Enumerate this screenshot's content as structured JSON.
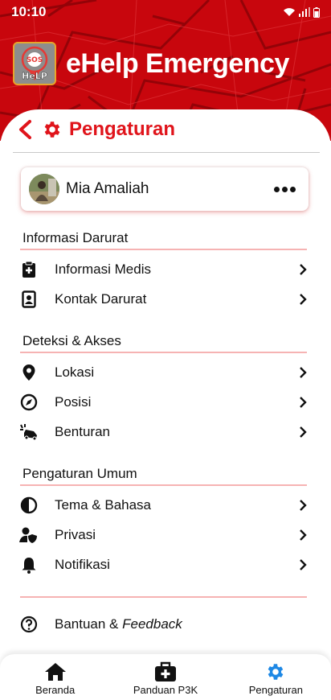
{
  "status_bar": {
    "time": "10:10"
  },
  "app": {
    "title": "eHelp Emergency",
    "logo_text_top": "SOS",
    "logo_text_bottom": "HeLP"
  },
  "page": {
    "title": "Pengaturan"
  },
  "profile": {
    "name": "Mia Amaliah"
  },
  "sections": [
    {
      "title": "Informasi Darurat",
      "items": [
        {
          "label": "Informasi Medis",
          "icon": "medical-clipboard-icon"
        },
        {
          "label": "Kontak Darurat",
          "icon": "contact-card-icon"
        }
      ]
    },
    {
      "title": "Deteksi & Akses",
      "items": [
        {
          "label": "Lokasi",
          "icon": "location-pin-icon"
        },
        {
          "label": "Posisi",
          "icon": "compass-icon"
        },
        {
          "label": "Benturan",
          "icon": "car-crash-icon"
        }
      ]
    },
    {
      "title": "Pengaturan Umum",
      "items": [
        {
          "label": "Tema & Bahasa",
          "icon": "theme-contrast-icon"
        },
        {
          "label": "Privasi",
          "icon": "user-shield-icon"
        },
        {
          "label": "Notifikasi",
          "icon": "bell-icon"
        }
      ]
    }
  ],
  "help": {
    "label_main": "Bantuan & ",
    "label_italic": "Feedback"
  },
  "nav": {
    "items": [
      {
        "label": "Beranda",
        "icon": "home-icon"
      },
      {
        "label": "Panduan P3K",
        "icon": "first-aid-kit-icon"
      },
      {
        "label": "Pengaturan",
        "icon": "gear-icon",
        "active": true
      }
    ]
  },
  "colors": {
    "brand_red": "#e0141b",
    "header_red": "#c8060d",
    "active_nav": "#1e88e5"
  }
}
